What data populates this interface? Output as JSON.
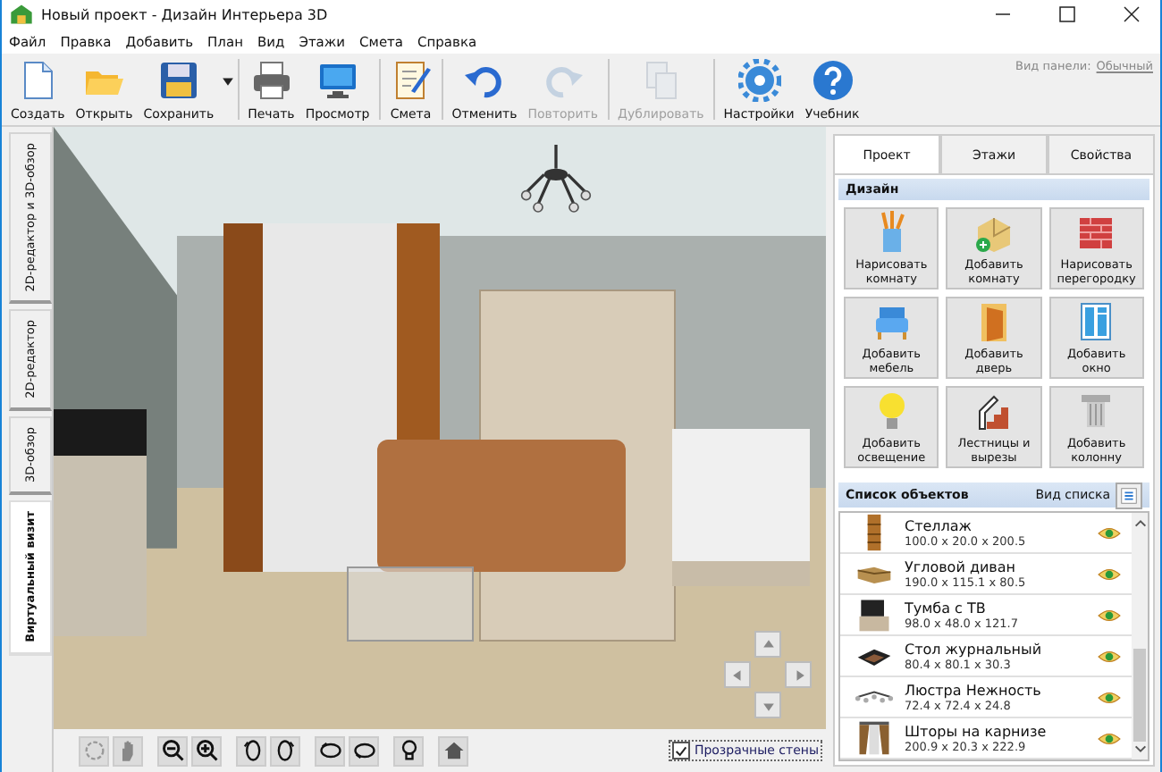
{
  "window": {
    "title": "Новый проект - Дизайн Интерьера 3D"
  },
  "menu": [
    "Файл",
    "Правка",
    "Добавить",
    "План",
    "Вид",
    "Этажи",
    "Смета",
    "Справка"
  ],
  "toolbar": {
    "groups": [
      [
        {
          "label": "Создать",
          "disabled": false,
          "dropdown": false
        },
        {
          "label": "Открыть",
          "disabled": false,
          "dropdown": false
        },
        {
          "label": "Сохранить",
          "disabled": false,
          "dropdown": true
        }
      ],
      [
        {
          "label": "Печать",
          "disabled": false,
          "dropdown": false
        },
        {
          "label": "Просмотр",
          "disabled": false,
          "dropdown": false
        }
      ],
      [
        {
          "label": "Смета",
          "disabled": false,
          "dropdown": false
        }
      ],
      [
        {
          "label": "Отменить",
          "disabled": false,
          "dropdown": false
        },
        {
          "label": "Повторить",
          "disabled": true,
          "dropdown": false
        }
      ],
      [
        {
          "label": "Дублировать",
          "disabled": true,
          "dropdown": false
        }
      ],
      [
        {
          "label": "Настройки",
          "disabled": false,
          "dropdown": false
        },
        {
          "label": "Учебник",
          "disabled": false,
          "dropdown": false
        }
      ]
    ],
    "panel_view_label": "Вид панели:",
    "panel_view_link": "Обычный"
  },
  "view_tabs": [
    {
      "label": "2D-редактор и 3D-обзор",
      "selected": false
    },
    {
      "label": "2D-редактор",
      "selected": false
    },
    {
      "label": "3D-обзор",
      "selected": false
    },
    {
      "label": "Виртуальный визит",
      "selected": true
    }
  ],
  "view_controls": {
    "transparent_walls": {
      "label": "Прозрачные стены",
      "checked": true
    }
  },
  "panel": {
    "tabs": [
      {
        "label": "Проект",
        "selected": true
      },
      {
        "label": "Этажи",
        "selected": false
      },
      {
        "label": "Свойства",
        "selected": false
      }
    ],
    "design_title": "Дизайн",
    "design_buttons": [
      "Нарисовать комнату",
      "Добавить комнату",
      "Нарисовать перегородку",
      "Добавить мебель",
      "Добавить дверь",
      "Добавить окно",
      "Добавить освещение",
      "Лестницы и вырезы",
      "Добавить колонну"
    ],
    "objects_title": "Список объектов",
    "list_view_label": "Вид списка",
    "objects": [
      {
        "name": "Стеллаж",
        "size": "100.0 x 20.0 x 200.5",
        "visible": true
      },
      {
        "name": "Угловой диван",
        "size": "190.0 x 115.1 x 80.5",
        "visible": true
      },
      {
        "name": "Тумба с ТВ",
        "size": "98.0 x 48.0 x 121.7",
        "visible": true
      },
      {
        "name": "Стол журнальный",
        "size": "80.4 x 80.1 x 30.3",
        "visible": true
      },
      {
        "name": "Люстра Нежность",
        "size": "72.4 x 72.4 x 24.8",
        "visible": true
      },
      {
        "name": "Шторы на карнизе",
        "size": "200.9 x 20.3 x 222.9",
        "visible": true
      }
    ]
  }
}
